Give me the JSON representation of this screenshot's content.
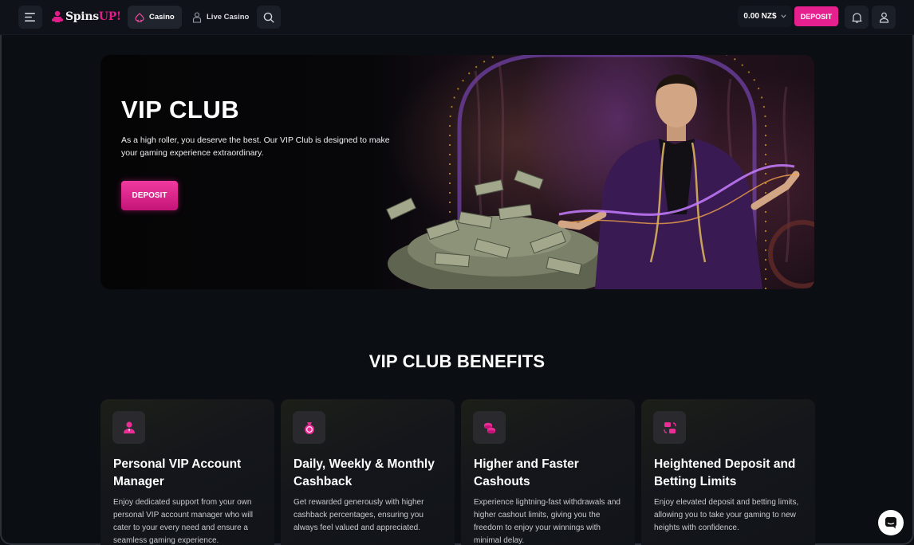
{
  "header": {
    "logo": {
      "part1": "Spins",
      "part2": "UP!"
    },
    "tabs": [
      {
        "label": "Casino",
        "icon": "spade-icon",
        "active": true
      },
      {
        "label": "Live Casino",
        "icon": "dealer-icon",
        "active": false
      }
    ],
    "balance": "0.00 NZ$",
    "deposit_label": "DEPOSIT"
  },
  "hero": {
    "title": "VIP CLUB",
    "description": "As a high roller, you deserve the best. Our VIP Club is designed to make your gaming experience extraordinary.",
    "deposit_label": "DEPOSIT"
  },
  "benefits": {
    "title": "VIP CLUB BENEFITS",
    "cards": [
      {
        "icon": "account-manager-icon",
        "title": "Personal VIP Account Manager",
        "description": "Enjoy dedicated support from your own personal VIP account manager who will cater to your every need and ensure a seamless gaming experience."
      },
      {
        "icon": "cashback-icon",
        "title": "Daily, Weekly & Monthly Cashback",
        "description": "Get rewarded generously with higher cashback percentages, ensuring you always feel valued and appreciated."
      },
      {
        "icon": "coins-icon",
        "title": "Higher and Faster Cashouts",
        "description": "Experience lightning-fast withdrawals and higher cashout limits, giving you the freedom to enjoy your winnings with minimal delay."
      },
      {
        "icon": "limits-icon",
        "title": "Heightened Deposit and Betting Limits",
        "description": "Enjoy elevated deposit and betting limits, allowing you to take your gaming to new heights with confidence."
      }
    ]
  },
  "colors": {
    "accent": "#e6208f",
    "background": "#0b0e13",
    "card": "#15181d"
  }
}
